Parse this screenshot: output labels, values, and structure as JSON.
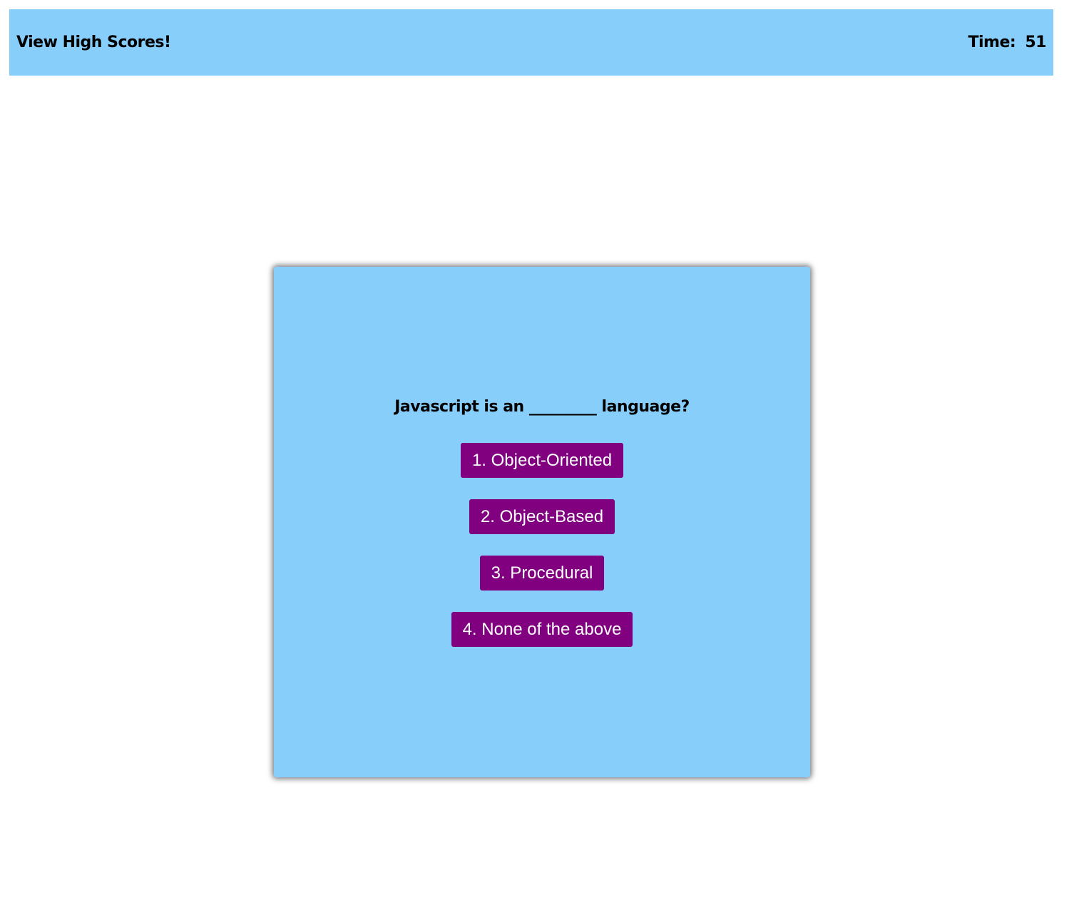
{
  "header": {
    "high_scores_label": "View High Scores!",
    "timer_label": "Time:",
    "timer_value": "51"
  },
  "quiz": {
    "question": "Javascript is an _________ language?",
    "choices": [
      {
        "label": "1. Object-Oriented"
      },
      {
        "label": "2. Object-Based"
      },
      {
        "label": "3. Procedural"
      },
      {
        "label": "4. None of the above"
      }
    ]
  },
  "colors": {
    "panel_background": "#87cefa",
    "button_background": "#800080",
    "button_text": "#ffffff",
    "text": "#000000"
  }
}
